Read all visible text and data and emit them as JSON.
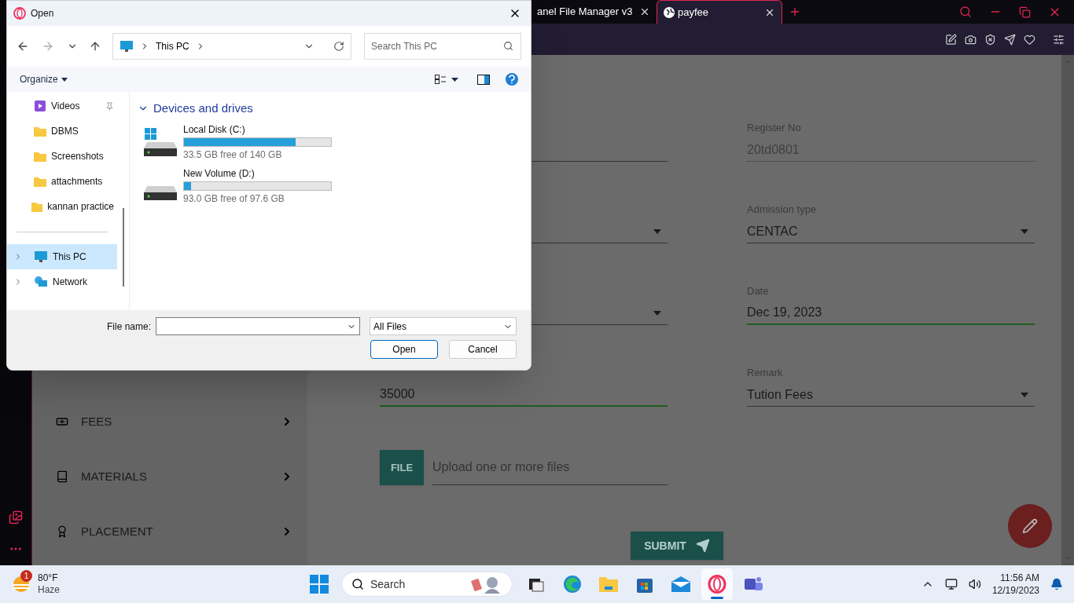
{
  "browser": {
    "tabs": [
      {
        "title": "anel File Manager v3",
        "selected": false
      },
      {
        "title": "payfee",
        "selected": true
      }
    ]
  },
  "nav": {
    "items": [
      {
        "label": "FEES",
        "kind": "money"
      },
      {
        "label": "MATERIALS",
        "kind": "book"
      },
      {
        "label": "PLACEMENT",
        "kind": "award"
      }
    ]
  },
  "form": {
    "left_fields": [
      {
        "kind": "text",
        "focused": false
      },
      {
        "kind": "select",
        "focused": false
      },
      {
        "kind": "select",
        "focused": false
      },
      {
        "kind": "text",
        "focused": true,
        "value": "35000"
      }
    ],
    "right_fields": [
      {
        "kind": "text",
        "label": "Register No",
        "value": "20td0801",
        "disabled": true,
        "focused": false
      },
      {
        "kind": "select",
        "label": "Admission type",
        "value": "CENTAC",
        "disabled": false,
        "focused": false
      },
      {
        "kind": "text",
        "label": "Date",
        "value": "Dec 19, 2023",
        "disabled": false,
        "focused": true
      },
      {
        "kind": "select",
        "label": "Remark",
        "value": "Tution Fees",
        "disabled": false,
        "focused": false
      }
    ],
    "upload": {
      "button": "FILE",
      "placeholder": "Upload one or more files"
    },
    "submit": "SUBMIT"
  },
  "dialog": {
    "title": "Open",
    "address": "This PC",
    "search_placeholder": "Search This PC",
    "organize": "Organize",
    "tree": [
      {
        "label": "Videos",
        "kind": "video",
        "pinned": true,
        "selected": false,
        "expandable": false
      },
      {
        "label": "DBMS",
        "kind": "folder",
        "pinned": false,
        "selected": false,
        "expandable": false
      },
      {
        "label": "Screenshots",
        "kind": "folder",
        "pinned": false,
        "selected": false,
        "expandable": false
      },
      {
        "label": "attachments",
        "kind": "folder",
        "pinned": false,
        "selected": false,
        "expandable": false
      },
      {
        "label": "kannan practice",
        "kind": "folder",
        "pinned": false,
        "selected": false,
        "expandable": false
      },
      {
        "kind": "divider"
      },
      {
        "label": "This PC",
        "kind": "pc",
        "pinned": false,
        "selected": true,
        "expandable": true
      },
      {
        "label": "Network",
        "kind": "network",
        "pinned": false,
        "selected": false,
        "expandable": true
      }
    ],
    "section": "Devices and drives",
    "drives": [
      {
        "name": "Local Disk (C:)",
        "system": true,
        "level": 0.76,
        "free": "33.5 GB free of 140 GB"
      },
      {
        "name": "New Volume (D:)",
        "system": false,
        "level": 0.047,
        "free": "93.0 GB free of 97.6 GB"
      }
    ],
    "file_name_label": "File name:",
    "file_type": "All Files",
    "buttons": [
      "Open",
      "Cancel"
    ]
  },
  "taskbar": {
    "weather": {
      "badge": "1",
      "temp": "80°F",
      "condition": "Haze"
    },
    "search": "Search",
    "apps": [
      {
        "kind": "taskview",
        "selected": false
      },
      {
        "kind": "edge",
        "selected": false
      },
      {
        "kind": "explorer",
        "selected": false
      },
      {
        "kind": "store",
        "selected": false
      },
      {
        "kind": "mail",
        "selected": false
      },
      {
        "kind": "opera",
        "selected": true
      },
      {
        "kind": "teams",
        "selected": false
      }
    ],
    "time": "11:56 AM",
    "date": "12/19/2023"
  }
}
